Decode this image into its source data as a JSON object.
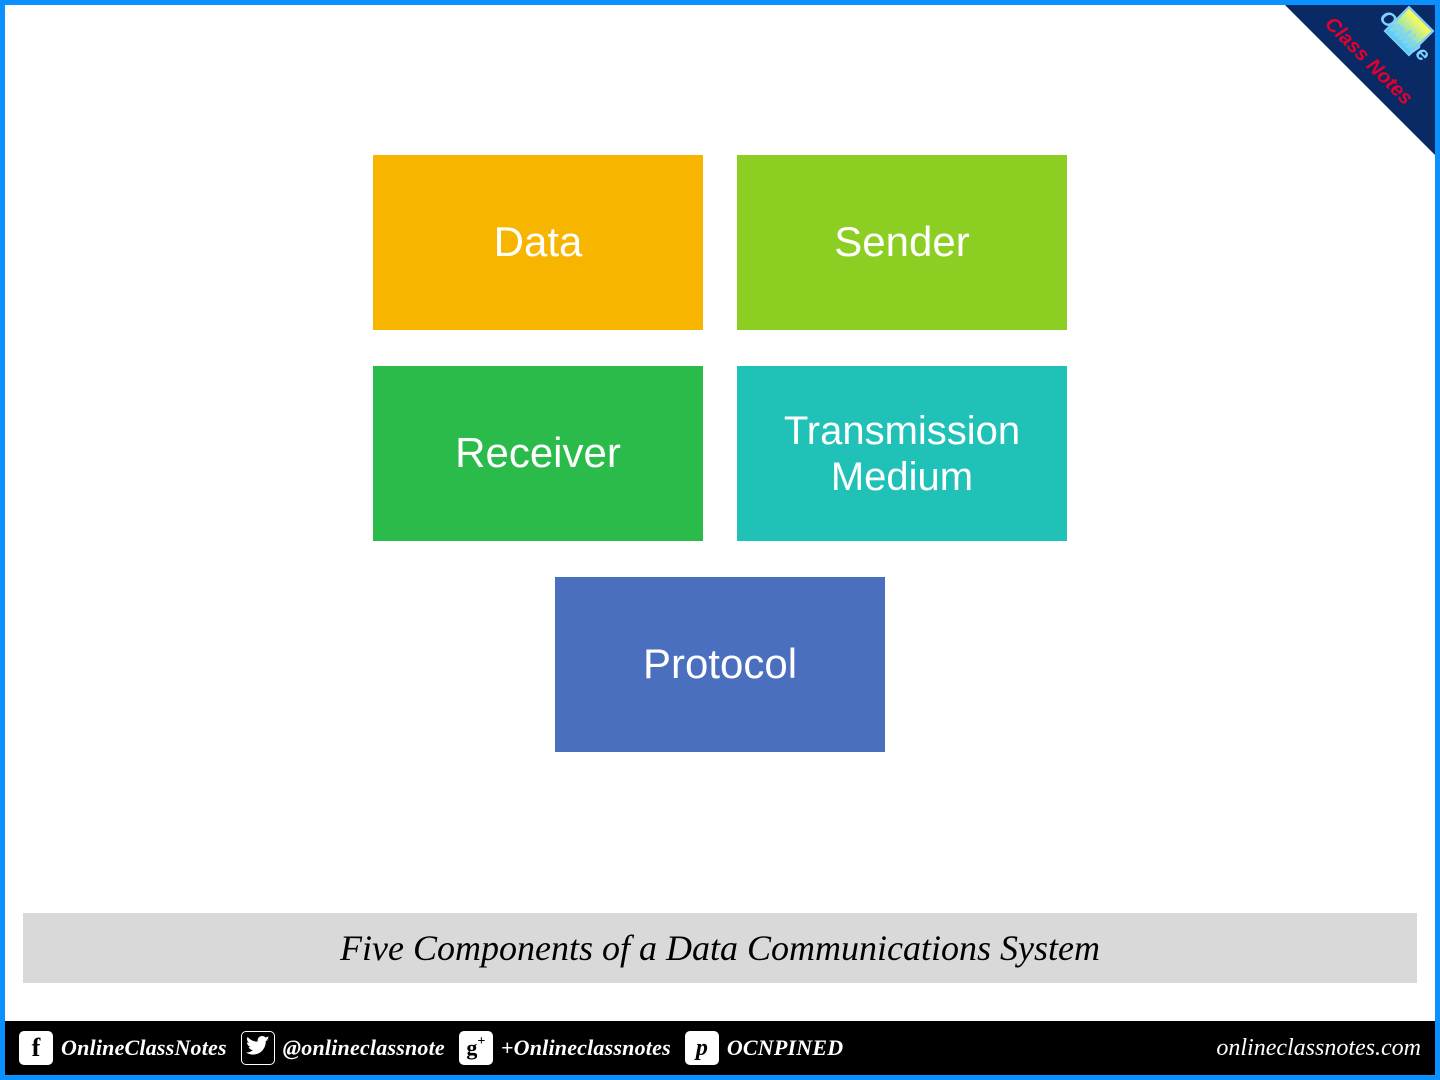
{
  "tiles": {
    "data": "Data",
    "sender": "Sender",
    "receiver": "Receiver",
    "medium_line1": "Transmission",
    "medium_line2": "Medium",
    "protocol": "Protocol"
  },
  "colors": {
    "data": "#f7b500",
    "sender": "#8dce22",
    "receiver": "#2bbb4a",
    "medium": "#20c2b8",
    "protocol": "#4a6fbf"
  },
  "caption": "Five Components of a Data Communications System",
  "ribbon": {
    "line1": "Online",
    "line2": "Class Notes"
  },
  "footer": {
    "fb": "OnlineClassNotes",
    "tw": "@onlineclassnote",
    "gp": "+Onlineclassnotes",
    "pn": "OCNPINED",
    "site": "onlineclassnotes.com"
  }
}
